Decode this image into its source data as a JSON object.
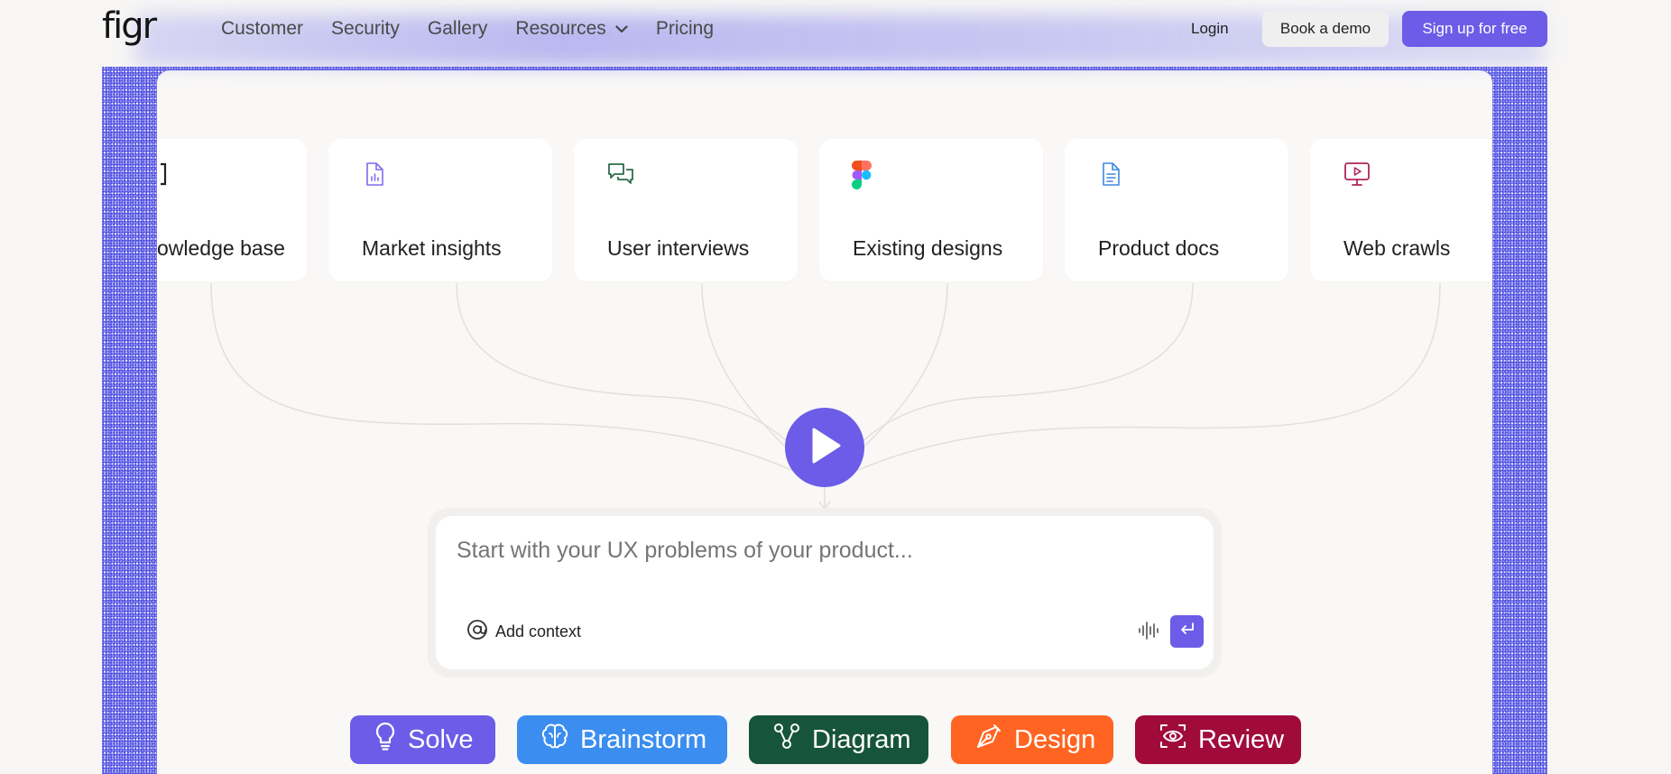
{
  "header": {
    "logo": "figr",
    "nav": [
      "Customer",
      "Security",
      "Gallery",
      "Resources",
      "Pricing"
    ],
    "login": "Login",
    "demo": "Book a demo",
    "signup": "Sign up for free"
  },
  "sources": [
    {
      "label": "owledge base",
      "icon": "bracket-icon",
      "color": "#222222"
    },
    {
      "label": "Market insights",
      "icon": "report-icon",
      "color": "#7b6cf0"
    },
    {
      "label": "User interviews",
      "icon": "chat-icon",
      "color": "#2f6b4c"
    },
    {
      "label": "Existing designs",
      "icon": "figma-icon",
      "color": "#f24e1e"
    },
    {
      "label": "Product docs",
      "icon": "document-icon",
      "color": "#3f87e0"
    },
    {
      "label": "Web crawls",
      "icon": "monitor-play-icon",
      "color": "#b0245a"
    }
  ],
  "input": {
    "placeholder": "Start with your UX problems of your product...",
    "add_context": "Add context"
  },
  "modes": [
    {
      "label": "Solve",
      "icon": "lightbulb-icon",
      "color": "#6c5ce7"
    },
    {
      "label": "Brainstorm",
      "icon": "brain-icon",
      "color": "#3b8ef0"
    },
    {
      "label": "Diagram",
      "icon": "flow-icon",
      "color": "#17543c"
    },
    {
      "label": "Design",
      "icon": "pen-tool-icon",
      "color": "#ff6422"
    },
    {
      "label": "Review",
      "icon": "eye-scan-icon",
      "color": "#a10b3c"
    }
  ]
}
